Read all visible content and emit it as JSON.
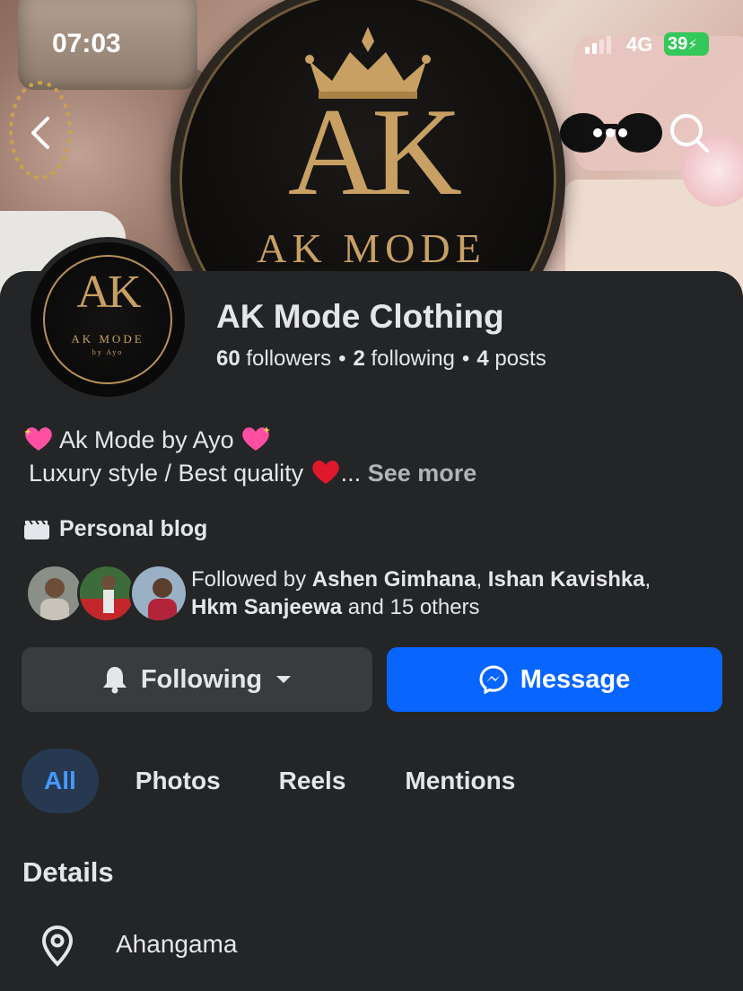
{
  "status_bar": {
    "time": "07:03",
    "network": "4G",
    "battery": "39"
  },
  "cover": {
    "logo_letters": "AK",
    "logo_text": "AK MODE"
  },
  "avatar": {
    "letters": "AK",
    "mode": "AK MODE",
    "by": "by Ayo"
  },
  "profile": {
    "name": "AK Mode Clothing",
    "followers_count": "60",
    "followers_label": "followers",
    "following_count": "2",
    "following_label": "following",
    "posts_count": "4",
    "posts_label": "posts",
    "separator": "•"
  },
  "bio": {
    "line1": "Ak Mode by Ayo",
    "line2": "Luxury style / Best quality",
    "ellipsis": "...",
    "see_more": "See more"
  },
  "category": {
    "label": "Personal blog",
    "icon": "clapperboard-icon"
  },
  "followed_by": {
    "prefix": "Followed by ",
    "name1": "Ashen Gimhana",
    "sep1": ", ",
    "name2": "Ishan Kavishka",
    "sep2": ",",
    "name3": "Hkm Sanjeewa",
    "suffix": " and 15 others"
  },
  "actions": {
    "following_label": "Following",
    "message_label": "Message"
  },
  "tabs": [
    {
      "label": "All",
      "active": true
    },
    {
      "label": "Photos",
      "active": false
    },
    {
      "label": "Reels",
      "active": false
    },
    {
      "label": "Mentions",
      "active": false
    }
  ],
  "details": {
    "title": "Details",
    "location": "Ahangama",
    "location_icon": "location-pin-icon"
  },
  "colors": {
    "background": "#242526",
    "primary": "#0866ff",
    "secondary_button": "#3a3b3c",
    "active_tab_bg": "#263951",
    "active_tab_text": "#4599ff",
    "gold": "#c9a063",
    "battery": "#34c759"
  }
}
